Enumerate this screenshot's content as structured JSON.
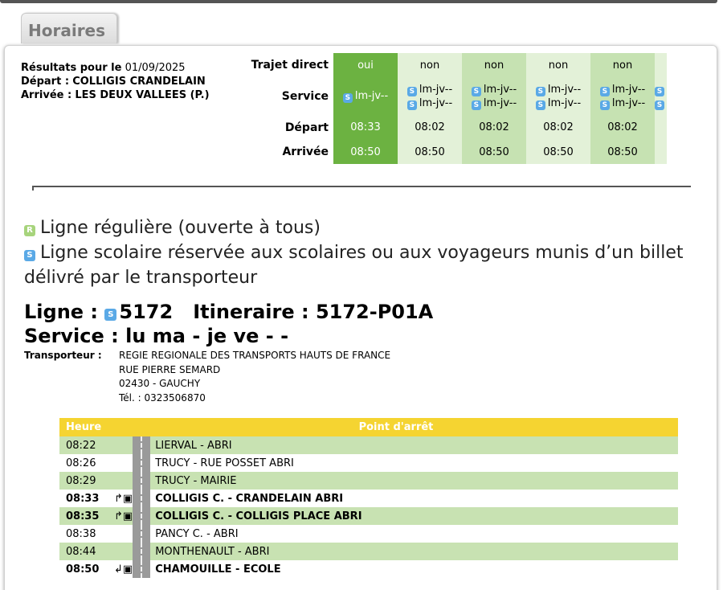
{
  "tab": {
    "label": "Horaires"
  },
  "result_info": {
    "date_label": "Résultats pour le",
    "date": "01/09/2025",
    "depart_label": "Départ :",
    "depart": "COLLIGIS CRANDELAIN",
    "arrivee_label": "Arrivée :",
    "arrivee": "LES DEUX VALLEES (P.)"
  },
  "trips": {
    "row_labels": {
      "direct": "Trajet direct",
      "service": "Service",
      "depart": "Départ",
      "arrivee": "Arrivée"
    },
    "columns": [
      {
        "direct": "oui",
        "service": [
          "lm-jv--"
        ],
        "depart": "08:33",
        "arrivee": "08:50"
      },
      {
        "direct": "non",
        "service": [
          "lm-jv--",
          "lm-jv--"
        ],
        "depart": "08:02",
        "arrivee": "08:50"
      },
      {
        "direct": "non",
        "service": [
          "lm-jv--",
          "lm-jv--"
        ],
        "depart": "08:02",
        "arrivee": "08:50"
      },
      {
        "direct": "non",
        "service": [
          "lm-jv--",
          "lm-jv--"
        ],
        "depart": "08:02",
        "arrivee": "08:50"
      },
      {
        "direct": "non",
        "service": [
          "lm-jv--",
          "lm-jv--"
        ],
        "depart": "08:02",
        "arrivee": "08:50"
      }
    ]
  },
  "legend": {
    "regular": "Ligne régulière (ouverte à tous)",
    "school": "Ligne scolaire réservée aux scolaires ou aux voyageurs munis d’un billet délivré par le transporteur"
  },
  "line": {
    "ligne_label": "Ligne :",
    "ligne_number": "5172",
    "itineraire_label": "Itineraire :",
    "itineraire": "5172-P01A",
    "service_label": "Service :",
    "service": "lu ma - je ve - -"
  },
  "transporteur": {
    "label": "Transporteur :",
    "name": "REGIE REGIONALE DES TRANSPORTS HAUTS DE FRANCE",
    "street": "RUE PIERRE SEMARD",
    "city": "02430 - GAUCHY",
    "phone": "Tél. : 0323506870"
  },
  "stops": {
    "headers": {
      "hour": "Heure",
      "stop": "Point d'arrêt"
    },
    "rows": [
      {
        "time": "08:22",
        "name": "LIERVAL - ABRI",
        "bold": false,
        "icon": ""
      },
      {
        "time": "08:26",
        "name": "TRUCY - RUE POSSET ABRI",
        "bold": false,
        "icon": ""
      },
      {
        "time": "08:29",
        "name": "TRUCY - MAIRIE",
        "bold": false,
        "icon": ""
      },
      {
        "time": "08:33",
        "name": "COLLIGIS C. - CRANDELAIN ABRI",
        "bold": true,
        "icon": "board-bus-icon"
      },
      {
        "time": "08:35",
        "name": "COLLIGIS C. - COLLIGIS PLACE ABRI",
        "bold": true,
        "icon": "board-bus-icon"
      },
      {
        "time": "08:38",
        "name": "PANCY C. - ABRI",
        "bold": false,
        "icon": ""
      },
      {
        "time": "08:44",
        "name": "MONTHENAULT - ABRI",
        "bold": false,
        "icon": ""
      },
      {
        "time": "08:50",
        "name": "CHAMOUILLE - ECOLE",
        "bold": true,
        "icon": "alight-bus-icon"
      }
    ]
  },
  "colors": {
    "selected": "#6cb241",
    "dark_green": "#c6e2b2",
    "light_green": "#e3f1d8",
    "header_yellow": "#f5d431",
    "school_icon": "#5aa9e6",
    "regular_icon": "#a7d47c"
  }
}
